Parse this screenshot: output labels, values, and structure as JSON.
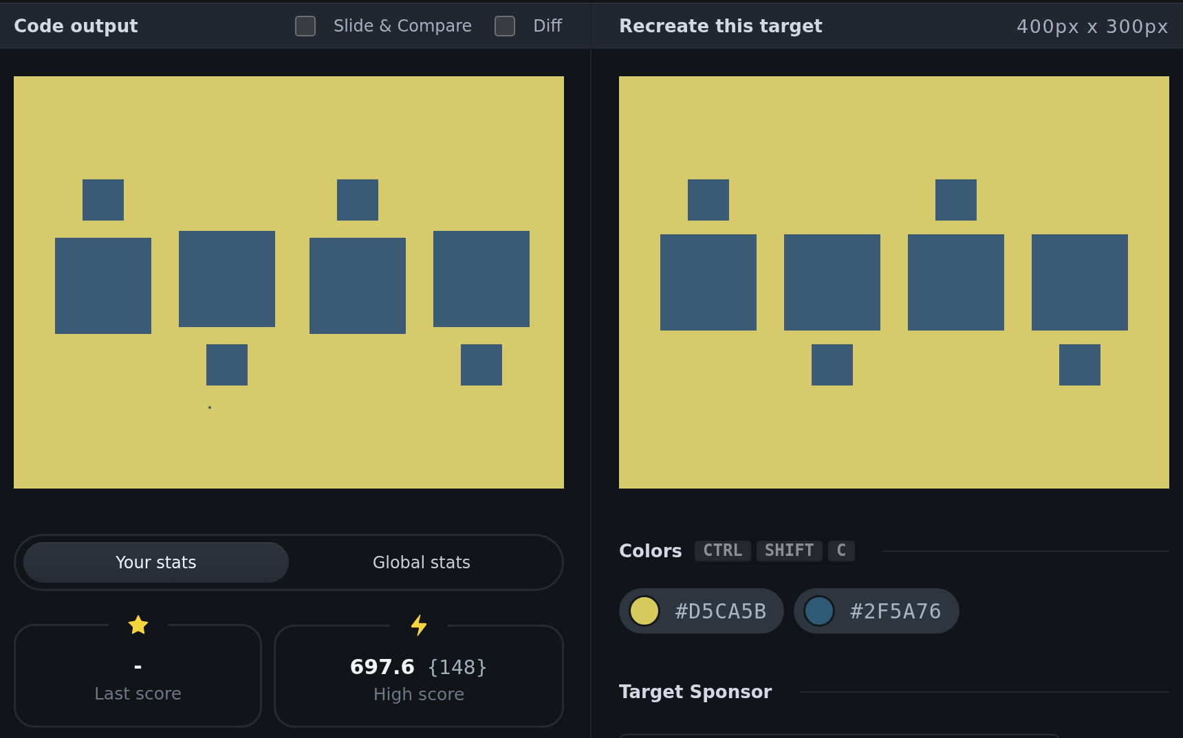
{
  "code_output": {
    "title": "Code output",
    "options": [
      {
        "label": "Slide & Compare",
        "checked": false
      },
      {
        "label": "Diff",
        "checked": false
      }
    ]
  },
  "target": {
    "title": "Recreate this target",
    "size": "400px x 300px"
  },
  "stats": {
    "tabs": [
      {
        "label": "Your stats",
        "selected": true
      },
      {
        "label": "Global stats",
        "selected": false
      }
    ],
    "cards": [
      {
        "kind": "star",
        "value": "-",
        "label": "Last score"
      },
      {
        "kind": "bolt",
        "value": "697.6",
        "count": "{148}",
        "label": "High score"
      }
    ]
  },
  "colors": {
    "title": "Colors",
    "shortcut": [
      "CTRL",
      "SHIFT",
      "C"
    ],
    "swatches": [
      {
        "hex": "#D5CA5B",
        "color": "#d5ca5b"
      },
      {
        "hex": "#2F5A76",
        "color": "#2f5a76"
      }
    ]
  },
  "sponsor": {
    "title": "Target Sponsor"
  }
}
